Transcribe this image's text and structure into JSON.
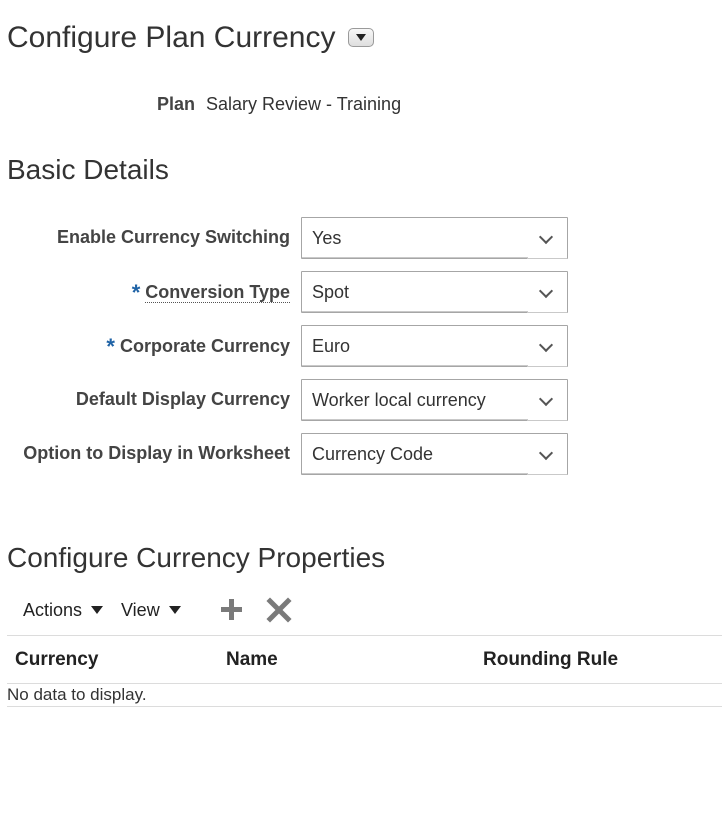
{
  "page": {
    "title": "Configure Plan Currency"
  },
  "plan": {
    "label": "Plan",
    "value": "Salary Review - Training"
  },
  "basic_details": {
    "title": "Basic Details",
    "fields": [
      {
        "label": "Enable Currency Switching",
        "value": "Yes",
        "required": false
      },
      {
        "label": "Conversion Type",
        "value": "Spot",
        "required": true
      },
      {
        "label": "Corporate Currency",
        "value": "Euro",
        "required": true
      },
      {
        "label": "Default Display Currency",
        "value": "Worker local currency",
        "required": false
      },
      {
        "label": "Option to Display in Worksheet",
        "value": "Currency Code",
        "required": false
      }
    ],
    "required_marker": "*"
  },
  "currency_properties": {
    "title": "Configure Currency Properties",
    "toolbar": {
      "actions_label": "Actions",
      "view_label": "View",
      "add_icon": "plus-icon",
      "delete_icon": "x-icon"
    },
    "table": {
      "columns": [
        "Currency",
        "Name",
        "Rounding Rule"
      ],
      "empty_message": "No data to display."
    }
  },
  "colors": {
    "required_marker": "#1f63a6",
    "toolbar_icon": "#7a7a7a",
    "text": "#333333"
  }
}
